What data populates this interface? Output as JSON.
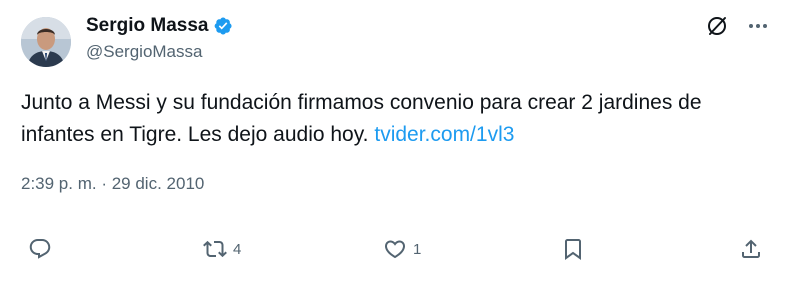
{
  "tweet": {
    "author": {
      "display_name": "Sergio Massa",
      "handle": "@SergioMassa",
      "verified": true
    },
    "text": "Junto a Messi y su fundación firmamos convenio para crear 2 jardines de infantes en Tigre. Les dejo audio hoy. ",
    "link_text": "tvider.com/1vl3",
    "time": "2:39 p. m.",
    "separator": " · ",
    "date": "29 dic. 2010"
  },
  "actions": {
    "reply_count": "",
    "retweet_count": "4",
    "like_count": "1"
  },
  "icons": {
    "verified": "verified-badge-icon",
    "grok": "grok-icon",
    "more": "more-icon",
    "reply": "reply-icon",
    "retweet": "retweet-icon",
    "like": "heart-icon",
    "bookmark": "bookmark-icon",
    "share": "share-icon"
  },
  "colors": {
    "accent": "#1d9bf0",
    "text_primary": "#0f1419",
    "text_secondary": "#536471"
  }
}
